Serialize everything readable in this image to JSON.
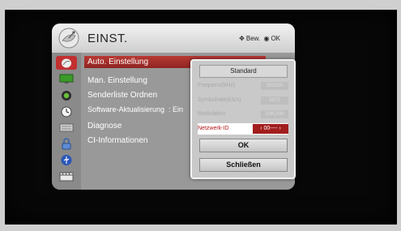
{
  "header": {
    "title": "EINST.",
    "nav_hint_move": "Bew.",
    "nav_hint_ok": "OK"
  },
  "categories": [
    {
      "icon": "settings-dish-icon",
      "selected": true
    },
    {
      "icon": "picture-icon",
      "selected": false
    },
    {
      "icon": "sound-icon",
      "selected": false
    },
    {
      "icon": "clock-icon",
      "selected": false
    },
    {
      "icon": "option-icon",
      "selected": false
    },
    {
      "icon": "lock-icon",
      "selected": false
    },
    {
      "icon": "usb-icon",
      "selected": false
    },
    {
      "icon": "media-icon",
      "selected": false
    }
  ],
  "menu_items": [
    {
      "label": "Auto. Einstellung",
      "selected": true
    },
    {
      "label": "Man. Einstellung"
    },
    {
      "label": "Senderliste Ordnen"
    },
    {
      "label": "Software-Aktualisierung",
      "value": ": Ein"
    },
    {
      "label": "Diagnose"
    },
    {
      "label": "CI-Informationen"
    }
  ],
  "popup": {
    "mode": "Standard",
    "fields": [
      {
        "label": "Frequenz(kHz)",
        "value": "302000"
      },
      {
        "label": "Symbolrate(kS/s)",
        "value": "6875"
      },
      {
        "label": "Modulation",
        "value": "256QAM"
      },
      {
        "label": "Netzwerk-ID",
        "value": "00----",
        "highlighted": true
      }
    ],
    "ok_label": "OK",
    "close_label": "Schließen"
  }
}
